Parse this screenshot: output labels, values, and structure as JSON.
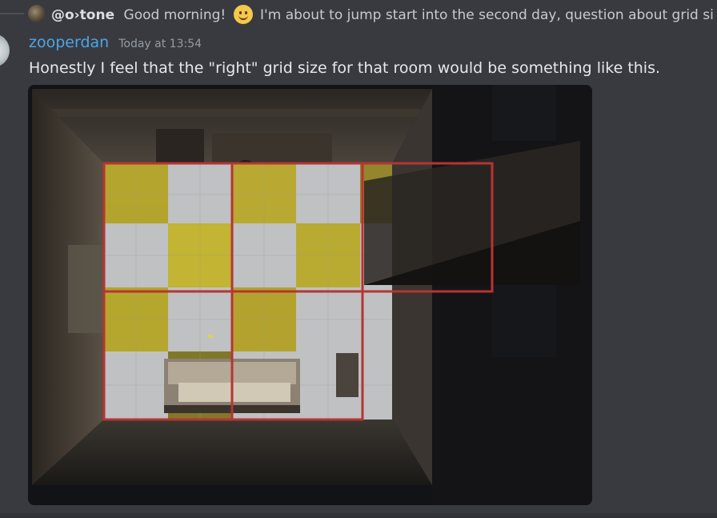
{
  "reply": {
    "author": "@o›tone",
    "text_before_emoji": "Good morning!",
    "emoji": "slightly-smiling-face",
    "text_after_emoji": "I'm about to jump start into the second day, question about grid si"
  },
  "message": {
    "username": "zooperdan",
    "timestamp": "Today at 13:54",
    "text": "Honestly I feel that the \"right\" grid size for that room would be something like this."
  },
  "attachment": {
    "type": "image",
    "description_icon": "image-attachment",
    "grid_overlay_color": "#b73432"
  },
  "colors": {
    "background": "#393a3f",
    "username": "#4aa6e8",
    "timestamp": "#949ba4",
    "text": "#e5e7eb"
  }
}
